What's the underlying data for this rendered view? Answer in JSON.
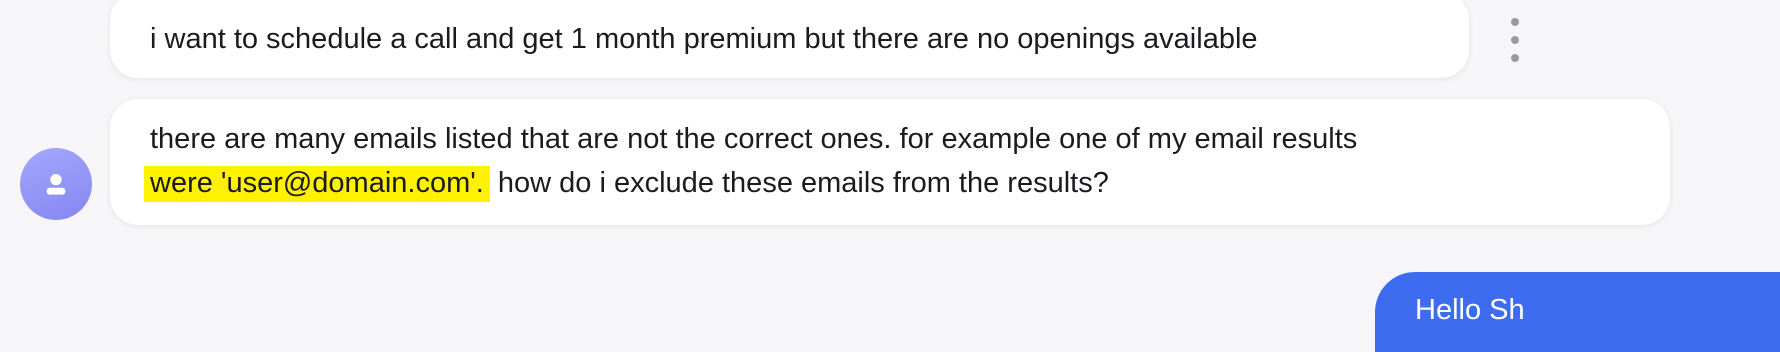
{
  "messages": [
    {
      "text": "i want to schedule a call and get 1 month premium but there are no openings available"
    },
    {
      "line1": "there are many emails listed that are not the correct ones. for example one of my email results",
      "highlight": "were 'user@domain.com'.",
      "rest": " how do i exclude these emails from the results?"
    }
  ],
  "reply": {
    "text": "Hello Sh"
  },
  "icons": {
    "menu": "more-vertical-icon",
    "avatar": "user-icon"
  },
  "colors": {
    "highlight": "#fff200",
    "avatar": "#8e90f5",
    "reply_bubble": "#3e6cf0"
  }
}
